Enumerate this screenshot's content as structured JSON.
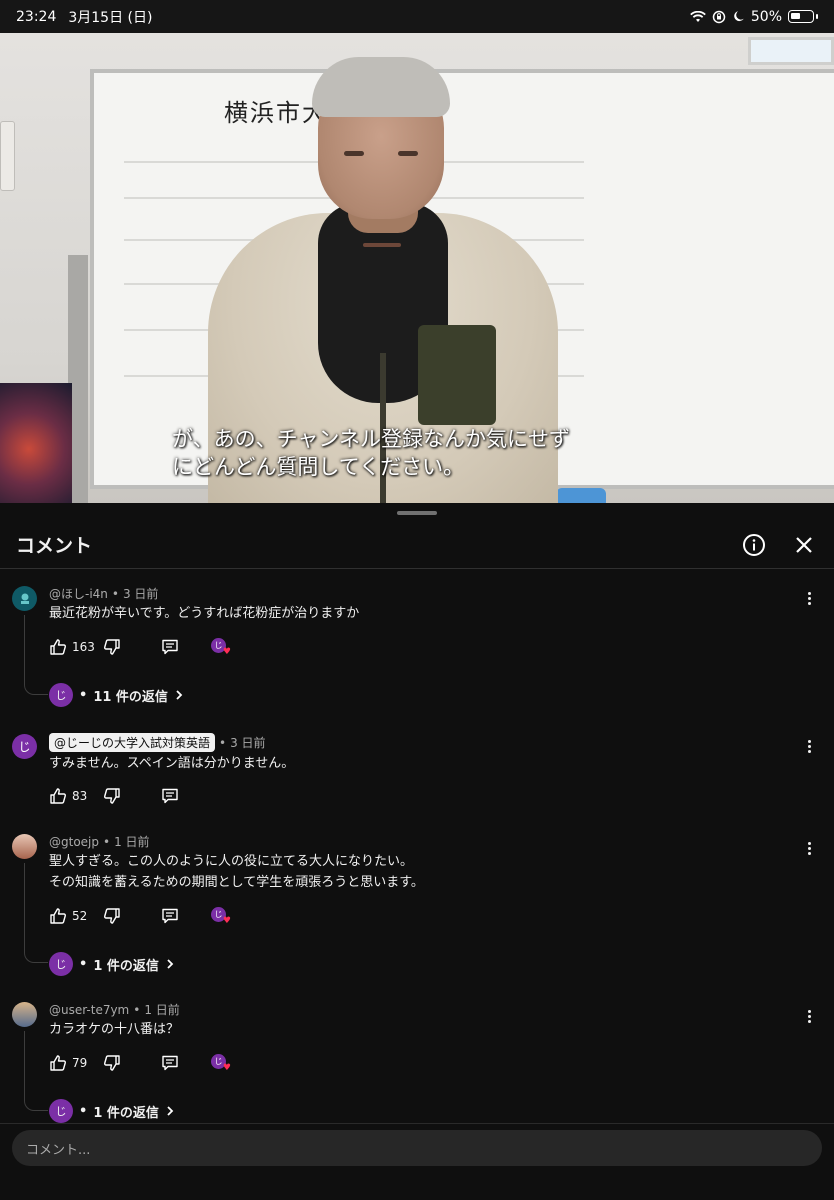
{
  "status_bar": {
    "time": "23:24",
    "date": "3月15日 (日)",
    "battery": "50%"
  },
  "video": {
    "whiteboard_text": "横浜市大",
    "caption": "が、あの、チャンネル登録なんか気にせず\nにどんどん質問してください。"
  },
  "panel": {
    "title": "コメント",
    "info_icon": "info-icon",
    "close_icon": "close-icon"
  },
  "comments": [
    {
      "author": "@ほし-i4n",
      "time": "3 日前",
      "text": "最近花粉が辛いです。どうすれば花粉症が治りますか",
      "likes": "163",
      "hearted": true,
      "replies": "11 件の返信",
      "avatar_label": ""
    },
    {
      "author": "@じーじの大学入試対策英語",
      "time": "3 日前",
      "text": "すみません。スペイン語は分かりません。",
      "likes": "83",
      "hearted": false,
      "is_creator": true,
      "avatar_label": "じ"
    },
    {
      "author": "@gtoejp",
      "time": "1 日前",
      "text": "聖人すぎる。この人のように人の役に立てる大人になりたい。\nその知識を蓄えるための期間として学生を頑張ろうと思います。",
      "likes": "52",
      "hearted": true,
      "replies": "1 件の返信",
      "avatar_label": ""
    },
    {
      "author": "@user-te7ym",
      "time": "1 日前",
      "text": "カラオケの十八番は？",
      "likes": "79",
      "hearted": true,
      "replies": "1 件の返信",
      "avatar_label": ""
    }
  ],
  "creator_avatar_label": "じ",
  "input": {
    "placeholder": "コメント..."
  },
  "colors": {
    "creator_avatar": "#7b2fa6",
    "heart": "#ff2d55",
    "background": "#0f0f0f",
    "input": "#272727"
  }
}
